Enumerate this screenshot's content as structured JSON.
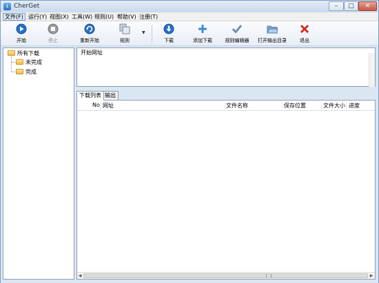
{
  "window": {
    "title": "CherGet"
  },
  "menu": [
    {
      "label": "文件(F)"
    },
    {
      "label": "运行(Y)"
    },
    {
      "label": "视图(X)"
    },
    {
      "label": "工具(W)"
    },
    {
      "label": "规则(U)"
    },
    {
      "label": "帮助(V)"
    },
    {
      "label": "注册(T)"
    }
  ],
  "toolbar": {
    "start": "开始",
    "stop": "停止",
    "restart": "重新开始",
    "rules": "规则",
    "download": "下载",
    "add_download": "添加下载",
    "rule_editor": "规则编辑器",
    "open_output_dir": "打开输出目录",
    "exit": "退出"
  },
  "tree": {
    "root": "所有下载",
    "children": [
      "未完成",
      "完成"
    ]
  },
  "url_panel": {
    "label": "开始网址"
  },
  "tabs": {
    "download_list": "下载列表",
    "output": "输出"
  },
  "columns": {
    "no": "No",
    "url": "网址",
    "filename": "文件名称",
    "save_location": "保存位置",
    "filesize": "文件大小",
    "progress": "进度"
  },
  "colors": {
    "accent_blue": "#2672c4",
    "exit_red": "#d42a20",
    "folder_yellow": "#f0b94b",
    "add_blue": "#3d8ad8"
  }
}
